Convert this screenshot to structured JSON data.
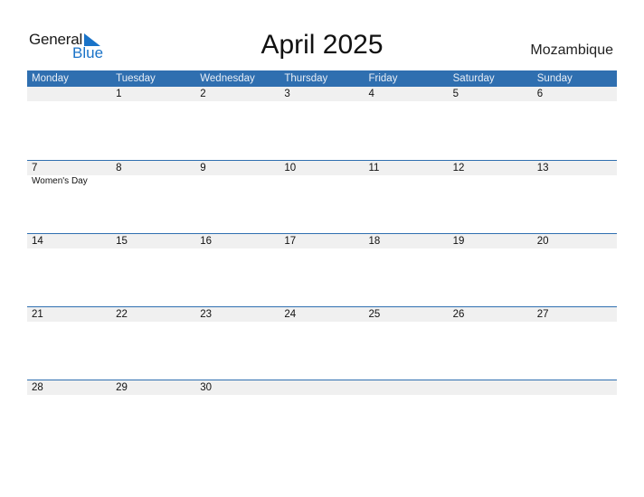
{
  "logo": {
    "word1": "General",
    "word2": "Blue",
    "accent": "#1a73c8"
  },
  "title": "April 2025",
  "country": "Mozambique",
  "colors": {
    "header_bg": "#2f6fb0",
    "date_row_bg": "#f0f0f0"
  },
  "weekdays": [
    "Monday",
    "Tuesday",
    "Wednesday",
    "Thursday",
    "Friday",
    "Saturday",
    "Sunday"
  ],
  "weeks": [
    {
      "days": [
        "",
        "1",
        "2",
        "3",
        "4",
        "5",
        "6"
      ],
      "events": [
        "",
        "",
        "",
        "",
        "",
        "",
        ""
      ]
    },
    {
      "days": [
        "7",
        "8",
        "9",
        "10",
        "11",
        "12",
        "13"
      ],
      "events": [
        "Women's Day",
        "",
        "",
        "",
        "",
        "",
        ""
      ]
    },
    {
      "days": [
        "14",
        "15",
        "16",
        "17",
        "18",
        "19",
        "20"
      ],
      "events": [
        "",
        "",
        "",
        "",
        "",
        "",
        ""
      ]
    },
    {
      "days": [
        "21",
        "22",
        "23",
        "24",
        "25",
        "26",
        "27"
      ],
      "events": [
        "",
        "",
        "",
        "",
        "",
        "",
        ""
      ]
    },
    {
      "days": [
        "28",
        "29",
        "30",
        "",
        "",
        "",
        ""
      ],
      "events": [
        "",
        "",
        "",
        "",
        "",
        "",
        ""
      ]
    }
  ]
}
